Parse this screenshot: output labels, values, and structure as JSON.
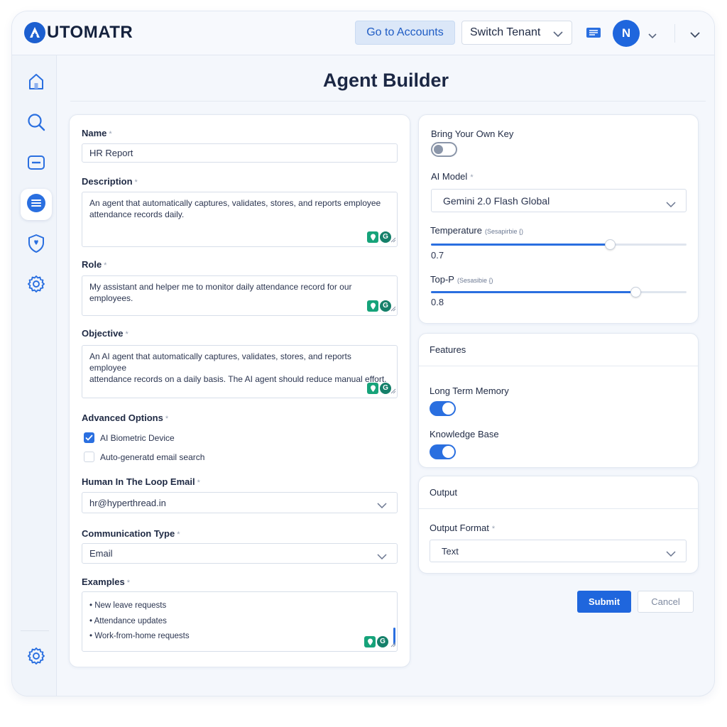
{
  "app": {
    "brand_letter": "A",
    "brand_name": "UTOMATR"
  },
  "header": {
    "go_to_accounts": "Go to Accounts",
    "switch_tenant": "Switch Tenant",
    "avatar_initial": "N",
    "icons": [
      "chevron-down-icon",
      "message-icon",
      "chevron-down-icon"
    ]
  },
  "sidebar": {
    "items": [
      {
        "name": "home",
        "icon": "home-icon",
        "active": false
      },
      {
        "name": "search",
        "icon": "search-icon",
        "active": false
      },
      {
        "name": "minus",
        "icon": "minus-box-icon",
        "active": false
      },
      {
        "name": "agents",
        "icon": "list-icon",
        "active": true
      },
      {
        "name": "security",
        "icon": "shield-icon",
        "active": false
      },
      {
        "name": "settings",
        "icon": "gear-icon",
        "active": false
      }
    ],
    "bottom_icon": "gear-icon"
  },
  "page": {
    "title": "Agent Builder"
  },
  "form": {
    "name": {
      "label": "Name",
      "req": "*",
      "value": "HR Report"
    },
    "description": {
      "label": "Description",
      "req": "*",
      "line1": "An agent that automatically captures, validates, stores, and reports employee",
      "line2": "attendance records daily."
    },
    "role": {
      "label": "Role",
      "req": "*",
      "value": "My assistant and helper me to monitor daily attendance record for our employees."
    },
    "objective": {
      "label": "Objective",
      "req": "*",
      "line1": "An AI agent that automatically captures, validates, stores, and reports employee",
      "line2": "attendance records on a daily basis. The AI agent should reduce manual effort."
    },
    "advanced": {
      "label": "Advanced Options",
      "req": "*",
      "options": [
        {
          "label": "AI Biometric Device",
          "checked": true
        },
        {
          "label": "Auto-generatd email search",
          "checked": false
        }
      ]
    },
    "hitl_email": {
      "label": "Human In The Loop Email",
      "req": "*",
      "value": "hr@hyperthread.in"
    },
    "comm_type": {
      "label": "Communication Type",
      "req": "*",
      "value": "Email"
    },
    "examples": {
      "label": "Examples",
      "req": "*",
      "items": [
        "New leave requests",
        "Attendance updates",
        "Work-from-home requests"
      ]
    },
    "textarea_badge_letter": "G"
  },
  "model": {
    "byok_label": "Bring Your Own Key",
    "byok_enabled": false,
    "ai_model_label": "AI Model",
    "ai_model_req": "*",
    "ai_model_value": "Gemini 2.0 Flash Global",
    "temperature": {
      "label": "Temperature",
      "hint": "(Sesapirbie {)",
      "value": "0.7",
      "fraction": 0.7
    },
    "top_p": {
      "label": "Top-P",
      "hint": "(Sesasibie {)",
      "value": "0.8",
      "fraction": 0.8
    }
  },
  "features": {
    "title": "Features",
    "long_term_memory": {
      "label": "Long Term Memory",
      "enabled": true
    },
    "knowledge_base": {
      "label": "Knowledge Base",
      "enabled": true
    }
  },
  "output": {
    "title": "Output",
    "format_label": "Output Format",
    "format_req": "*",
    "format_value": "Text"
  },
  "actions": {
    "submit": "Submit",
    "cancel": "Cancel"
  },
  "colors": {
    "primary": "#1f66dd",
    "accent_light": "#dbe7f8",
    "text": "#1f2a44",
    "badge": "#16a37a"
  }
}
